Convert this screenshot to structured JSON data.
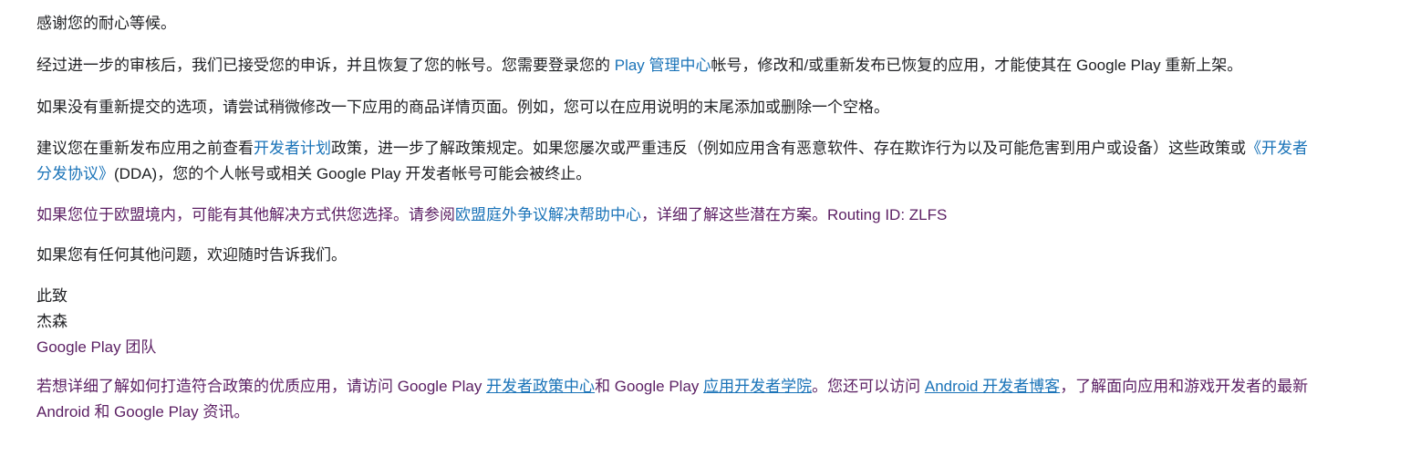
{
  "email": {
    "greeting": "感谢您的耐心等候。",
    "p1": {
      "before": "经过进一步的审核后，我们已接受您的申诉，并且恢复了您的帐号。您需要登录您的 ",
      "link": "Play 管理中心",
      "after": "帐号，修改和/或重新发布已恢复的应用，才能使其在 Google Play 重新上架。"
    },
    "p2": "如果没有重新提交的选项，请尝试稍微修改一下应用的商品详情页面。例如，您可以在应用说明的末尾添加或删除一个空格。",
    "p3": {
      "before": "建议您在重新发布应用之前查看",
      "link1": "开发者计划",
      "middle": "政策，进一步了解政策规定。如果您屡次或严重违反（例如应用含有恶意软件、存在欺诈行为以及可能危害到用户或设备）这些政策或",
      "link2_line1": "《开发者",
      "link2_line2": "分发协议》",
      "after": "(DDA)，您的个人帐号或相关 Google Play 开发者帐号可能会被终止。"
    },
    "p4": {
      "before": "如果您位于欧盟境内，可能有其他解决方式供您选择。请参阅",
      "link": "欧盟庭外争议解决帮助中心",
      "after": "，详细了解这些潜在方案。Routing ID: ZLFS"
    },
    "p5": "如果您有任何其他问题，欢迎随时告诉我们。",
    "signoff": {
      "closing": "此致",
      "name": "杰森",
      "team": "Google Play 团队"
    },
    "footer": {
      "t1": "若想详细了解如何打造符合政策的优质应用，请访问 Google Play ",
      "link1": "开发者政策中心",
      "t2": "和 Google Play ",
      "link2": "应用开发者学院",
      "t3": "。您还可以访问 ",
      "link3": "Android 开发者博客",
      "t4": "，了解面向应用和游戏开发者的最新",
      "line2": "Android 和 Google Play 资讯。"
    },
    "colors": {
      "text": "#202124",
      "purple_text": "#5b1f63",
      "link": "#1a73b8"
    }
  }
}
